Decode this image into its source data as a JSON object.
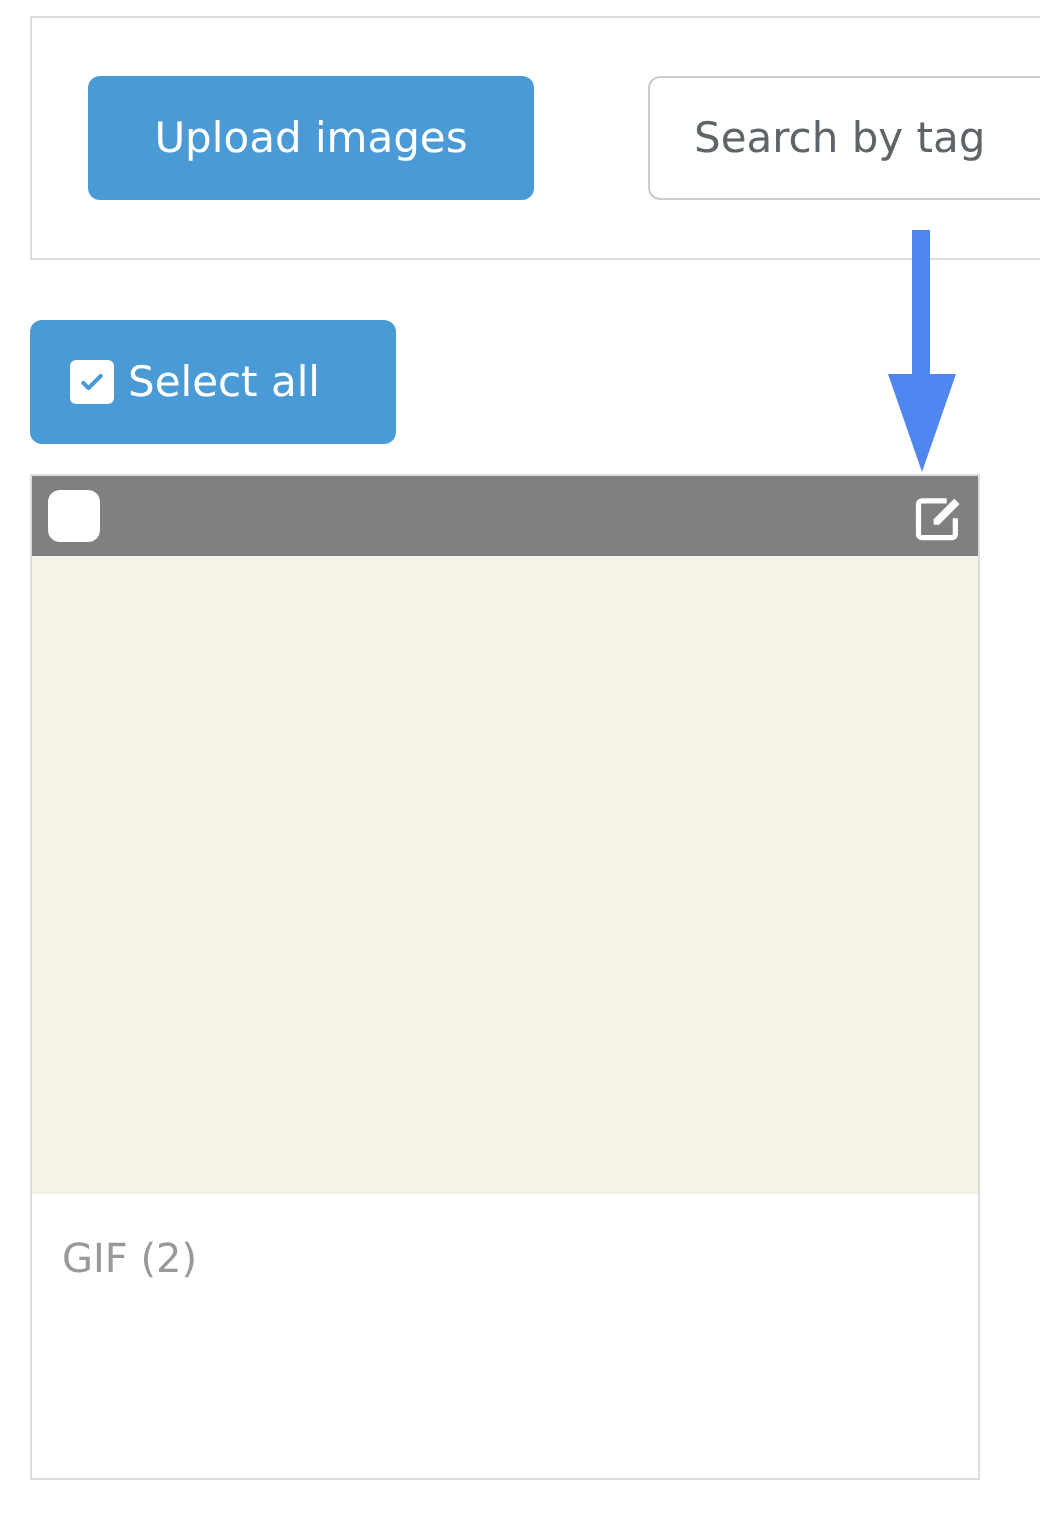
{
  "toolbar": {
    "upload_button": "Upload images",
    "search": {
      "placeholder": "Search by tag"
    }
  },
  "select_all": {
    "label": "Select all",
    "checked": true
  },
  "images": [
    {
      "selected": false,
      "caption": "GIF (2)",
      "kind": "picture"
    }
  ]
}
